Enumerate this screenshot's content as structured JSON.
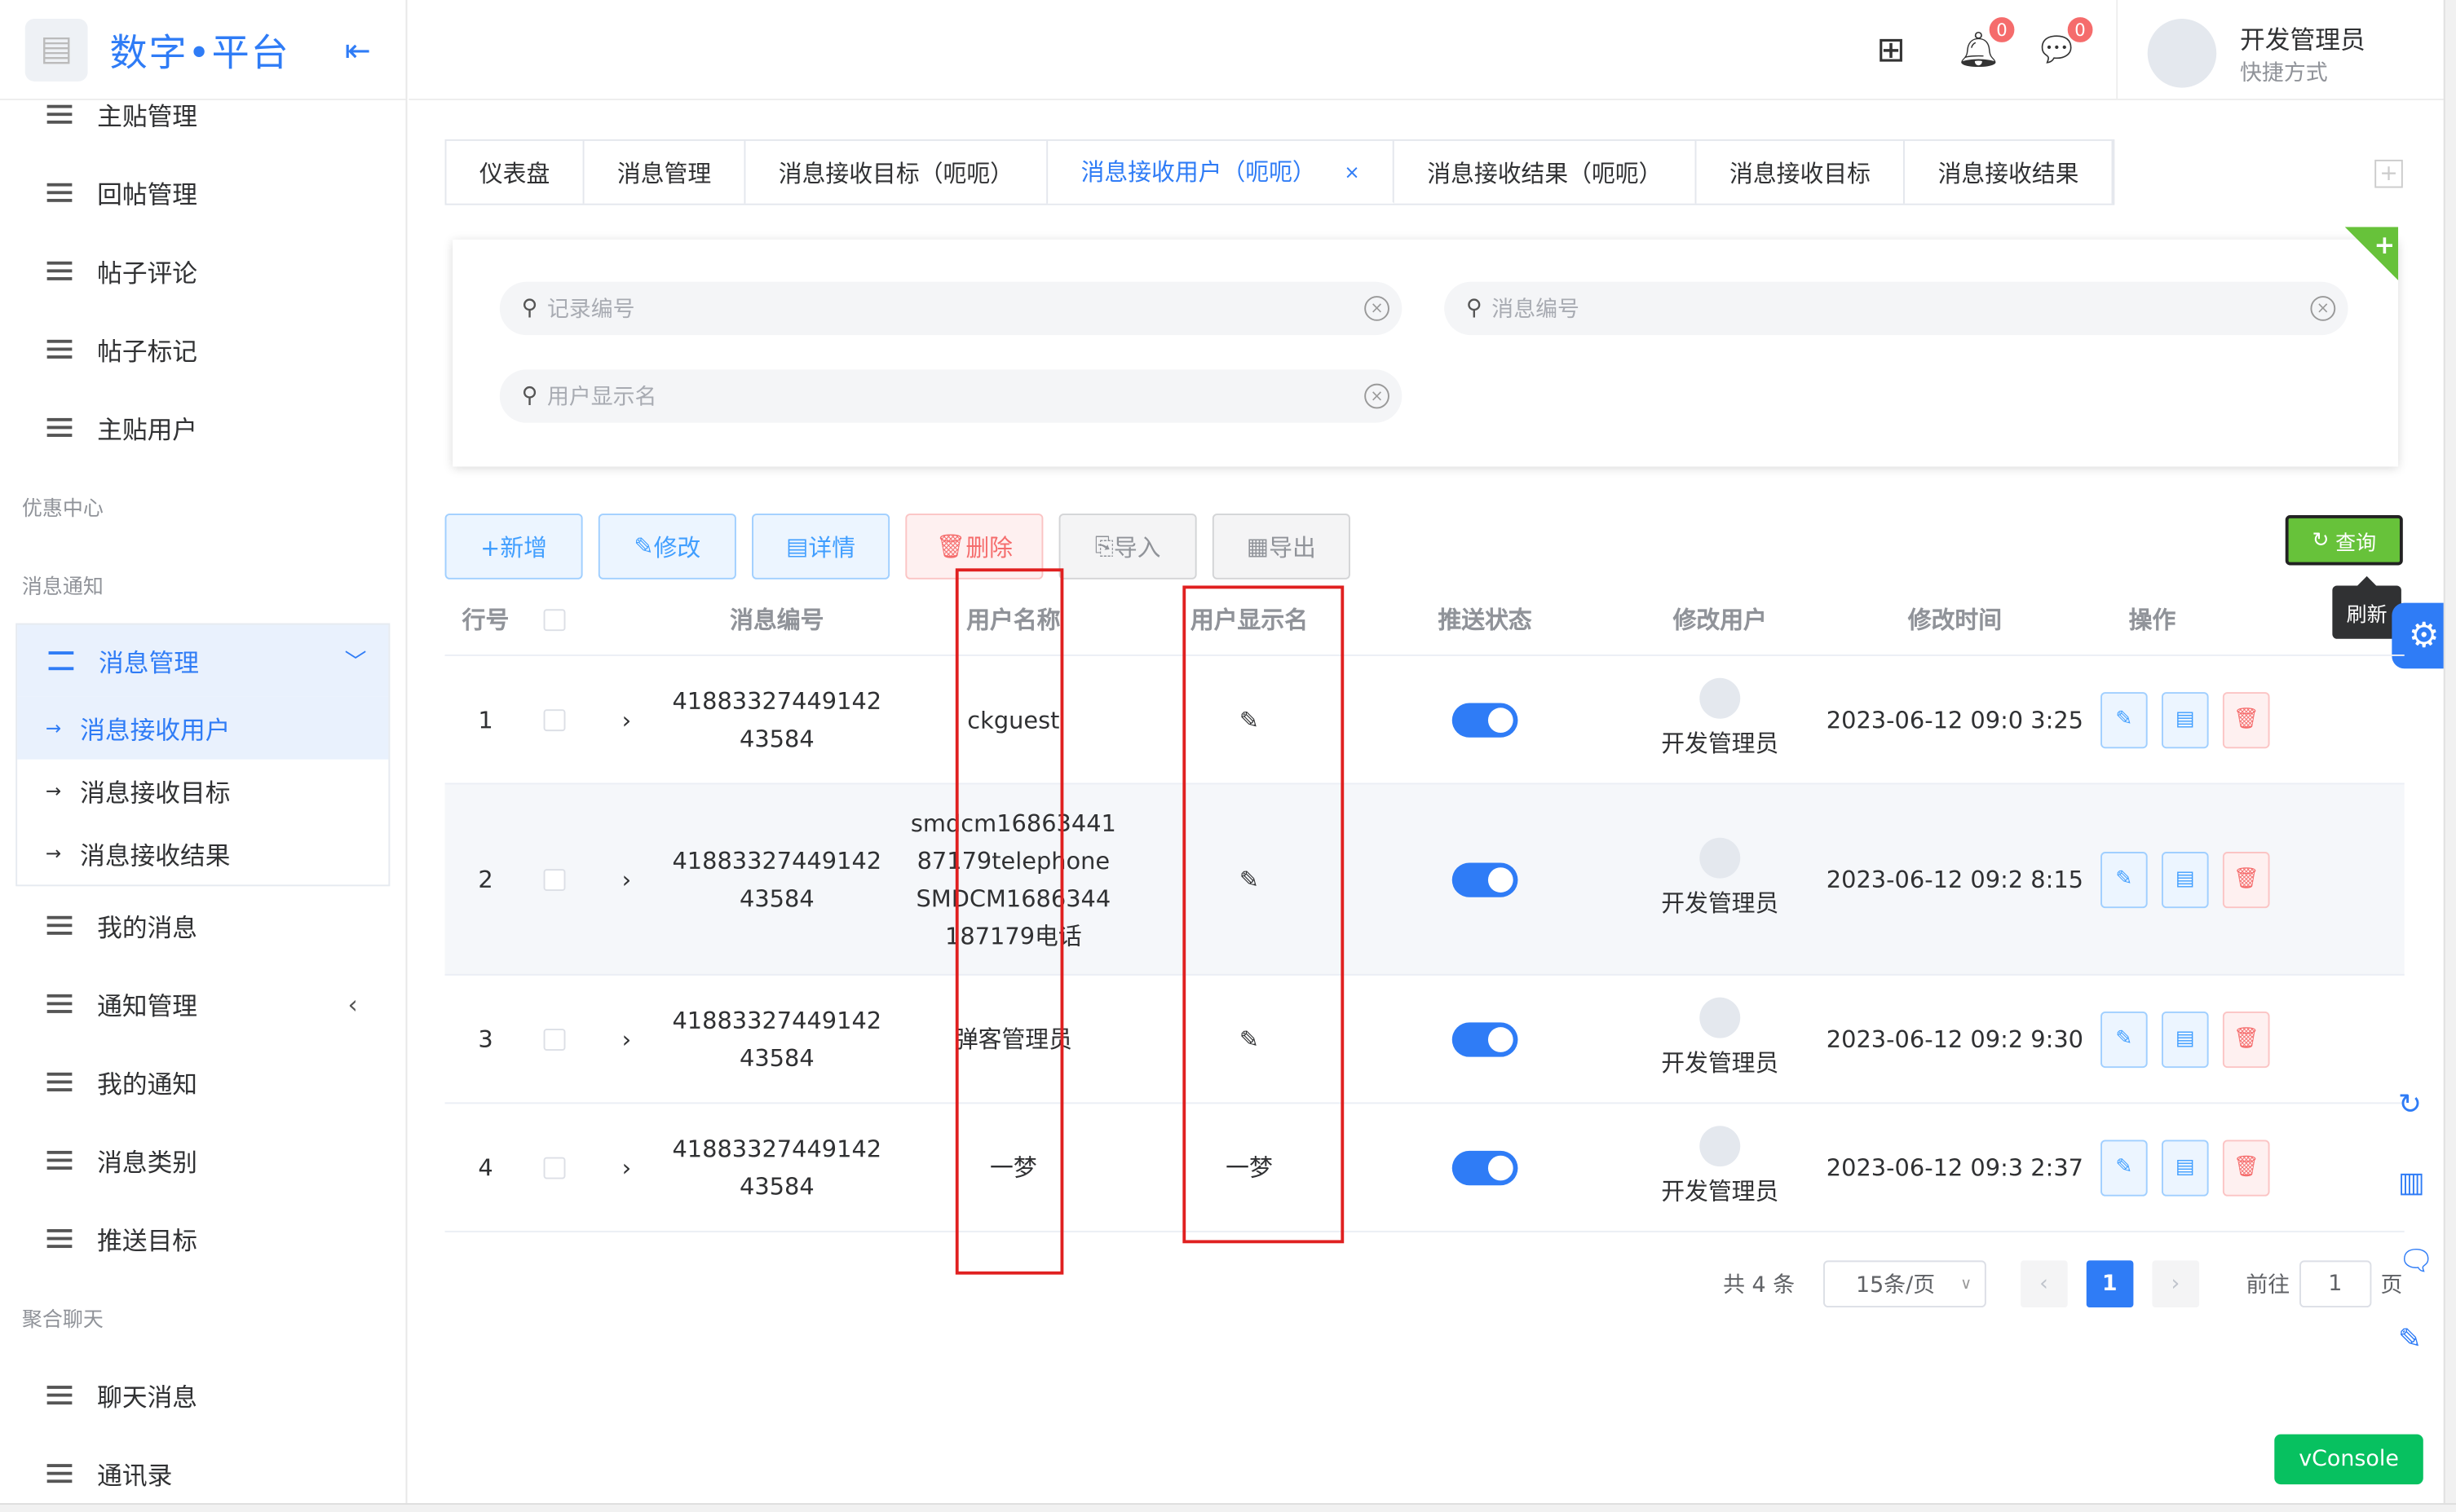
{
  "app": {
    "logo_text": "数字•平台"
  },
  "sidebar": {
    "top_items": [
      "主贴管理",
      "回帖管理",
      "帖子评论",
      "帖子标记",
      "主贴用户"
    ],
    "group_coupon": "优惠中心",
    "group_notify": "消息通知",
    "parent": "消息管理",
    "sub_items": [
      "消息接收用户",
      "消息接收目标",
      "消息接收结果"
    ],
    "items_after": [
      "我的消息",
      "通知管理",
      "我的通知",
      "消息类别",
      "推送目标"
    ],
    "group_chat": "聚合聊天",
    "chat_items": [
      "聊天消息",
      "通讯录"
    ]
  },
  "header": {
    "user_name": "开发管理员",
    "user_sub": "快捷方式",
    "bell_badge": "0",
    "msg_badge": "0"
  },
  "tabs": [
    "仪表盘",
    "消息管理",
    "消息接收目标（呃呃）",
    "消息接收用户（呃呃）",
    "消息接收结果（呃呃）",
    "消息接收目标",
    "消息接收结果"
  ],
  "search": {
    "record_no": "记录编号",
    "msg_no": "消息编号",
    "user_display": "用户显示名"
  },
  "toolbar": {
    "add": "+新增",
    "edit": "修改",
    "detail": "详情",
    "delete": "删除",
    "import": "导入",
    "export": "导出",
    "query": "查询",
    "refresh_tip": "刷新"
  },
  "table": {
    "headers": [
      "行号",
      "消息编号",
      "用户名称",
      "用户显示名",
      "推送状态",
      "修改用户",
      "修改时间",
      "操作"
    ],
    "rows": [
      {
        "no": "1",
        "msg": "41883327449142 43584",
        "uname": "ckguest",
        "udisp": "✎",
        "muser": "开发管理员",
        "mtime": "2023-06-12 09:0 3:25"
      },
      {
        "no": "2",
        "msg": "41883327449142 43584",
        "uname": "smdcm16863441 87179telephone SMDCM1686344 187179电话",
        "udisp": "✎",
        "muser": "开发管理员",
        "mtime": "2023-06-12 09:2 8:15"
      },
      {
        "no": "3",
        "msg": "41883327449142 43584",
        "uname": "弹客管理员",
        "udisp": "✎",
        "muser": "开发管理员",
        "mtime": "2023-06-12 09:2 9:30"
      },
      {
        "no": "4",
        "msg": "41883327449142 43584",
        "uname": "一梦",
        "udisp": "一梦",
        "muser": "开发管理员",
        "mtime": "2023-06-12 09:3 2:37"
      }
    ]
  },
  "pager": {
    "total": "共 4 条",
    "size": "15条/页",
    "current": "1",
    "goto": "前往",
    "goto_val": "1",
    "page_unit": "页"
  },
  "vconsole": "vConsole",
  "colors": {
    "primary": "#2f7cf6",
    "success": "#67c23a",
    "danger": "#f56c6c"
  }
}
